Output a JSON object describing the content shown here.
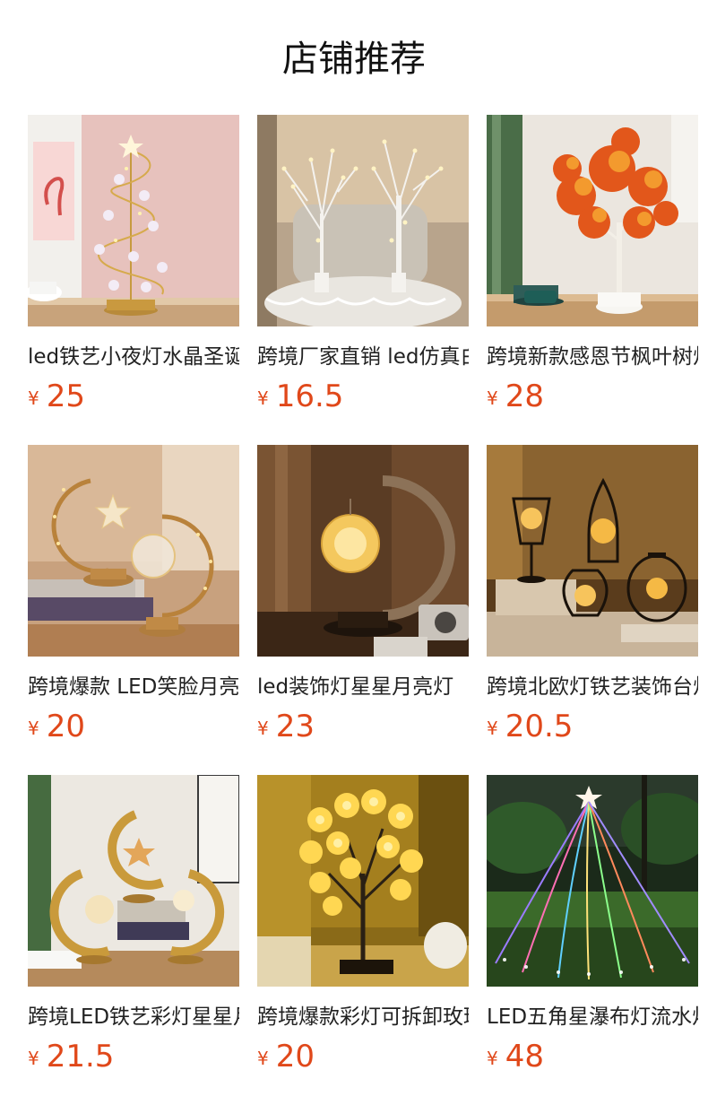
{
  "section_title": "店铺推荐",
  "products": [
    {
      "name": "led铁艺小夜灯水晶圣诞树",
      "currency": "¥",
      "price": "25",
      "image_icon": "crystal-christmas-tree-lamp-photo"
    },
    {
      "name": "跨境厂家直销 led仿真白桦树灯",
      "currency": "¥",
      "price": "16.5",
      "image_icon": "birch-tree-lamp-photo"
    },
    {
      "name": "跨境新款感恩节枫叶树灯",
      "currency": "¥",
      "price": "28",
      "image_icon": "maple-leaf-tree-lamp-photo"
    },
    {
      "name": "跨境爆款 LED笑脸月亮灯",
      "currency": "¥",
      "price": "20",
      "image_icon": "moon-star-lamp-photo"
    },
    {
      "name": "led装饰灯星星月亮灯",
      "currency": "¥",
      "price": "23",
      "image_icon": "moon-globe-lamp-photo"
    },
    {
      "name": "跨境北欧灯铁艺装饰台灯",
      "currency": "¥",
      "price": "20.5",
      "image_icon": "iron-cage-lamps-photo"
    },
    {
      "name": "跨境LED铁艺彩灯星星月亮",
      "currency": "¥",
      "price": "21.5",
      "image_icon": "golden-moon-lamps-photo"
    },
    {
      "name": "跨境爆款彩灯可拆卸玫瑰树",
      "currency": "¥",
      "price": "20",
      "image_icon": "rose-tree-lamp-photo"
    },
    {
      "name": "LED五角星瀑布灯流水灯",
      "currency": "¥",
      "price": "48",
      "image_icon": "star-waterfall-lights-photo"
    }
  ],
  "colors": {
    "price": "#e0481a",
    "title": "#111111",
    "name": "#222222"
  }
}
